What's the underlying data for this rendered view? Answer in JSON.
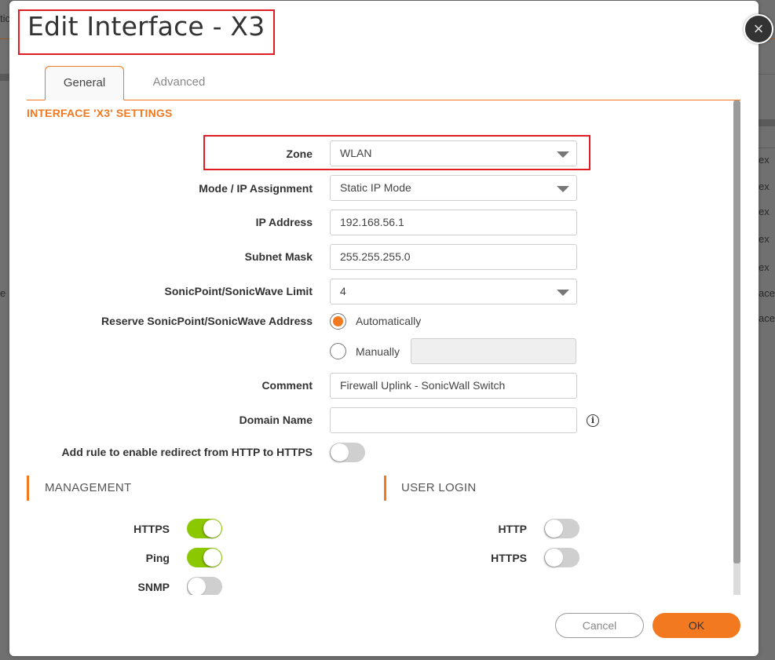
{
  "background": {
    "fragments": [
      "tic",
      "e",
      "ex",
      "ex",
      "ex",
      "ex",
      "ex",
      "ace",
      "ace"
    ]
  },
  "dialog": {
    "title": "Edit Interface - X3",
    "close_icon": "×",
    "tabs": [
      {
        "label": "General",
        "active": true
      },
      {
        "label": "Advanced",
        "active": false
      }
    ],
    "section_heading": "INTERFACE 'X3' SETTINGS",
    "form": {
      "zone": {
        "label": "Zone",
        "value": "WLAN"
      },
      "mode": {
        "label": "Mode / IP Assignment",
        "value": "Static IP Mode"
      },
      "ip_address": {
        "label": "IP Address",
        "value": "192.168.56.1"
      },
      "subnet_mask": {
        "label": "Subnet Mask",
        "value": "255.255.255.0"
      },
      "sonicpoint_limit": {
        "label": "SonicPoint/SonicWave Limit",
        "value": "4"
      },
      "reserve_address": {
        "label": "Reserve SonicPoint/SonicWave Address",
        "options": [
          {
            "label": "Automatically",
            "checked": true
          },
          {
            "label": "Manually",
            "checked": false
          }
        ],
        "manual_value": ""
      },
      "comment": {
        "label": "Comment",
        "value": "Firewall Uplink - SonicWall Switch"
      },
      "domain_name": {
        "label": "Domain Name",
        "value": "",
        "info_icon": "i"
      },
      "redirect": {
        "label": "Add rule to enable redirect from HTTP to HTTPS",
        "enabled": false
      }
    },
    "management": {
      "title": "MANAGEMENT",
      "items": [
        {
          "label": "HTTPS",
          "enabled": true
        },
        {
          "label": "Ping",
          "enabled": true
        },
        {
          "label": "SNMP",
          "enabled": false
        }
      ]
    },
    "user_login": {
      "title": "USER LOGIN",
      "items": [
        {
          "label": "HTTP",
          "enabled": false
        },
        {
          "label": "HTTPS",
          "enabled": false
        }
      ]
    },
    "buttons": {
      "cancel": "Cancel",
      "ok": "OK"
    },
    "colors": {
      "accent": "#f37920",
      "toggle_on": "#8cc800",
      "highlight": "#e21c24"
    }
  }
}
